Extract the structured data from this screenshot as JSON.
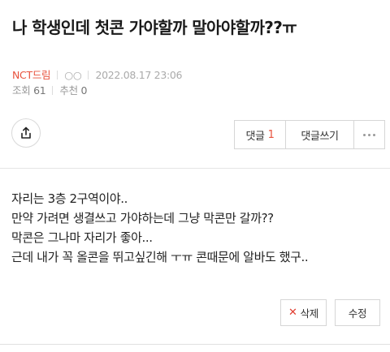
{
  "post": {
    "title": "나 학생인데 첫콘 가야할까 말아야할까??ㅠ",
    "author": "NCT드림",
    "author_extra": "○○",
    "datetime": "2022.08.17 23:06",
    "views_label": "조회",
    "views": "61",
    "recommend_label": "추천",
    "recommend": "0"
  },
  "actions": {
    "share_icon": "share-icon",
    "comment_label": "댓글",
    "comment_count": "1",
    "write_comment_label": "댓글쓰기",
    "more_icon": "more-dots-icon"
  },
  "content": {
    "lines": [
      "자리는 3층 2구역이야..",
      "만약 가려면 생결쓰고 가야하는데 그냥 막콘만 갈까??",
      "막콘은 그나마 자리가 좋아...",
      "근데 내가 꼭 올콘을 뛰고싶긴해 ㅜㅠ 콘때문에 알바도 했구.."
    ]
  },
  "footer": {
    "delete_label": "삭제",
    "edit_label": "수정"
  },
  "colors": {
    "accent": "#e8533e",
    "delete_x": "#e03b2e"
  }
}
